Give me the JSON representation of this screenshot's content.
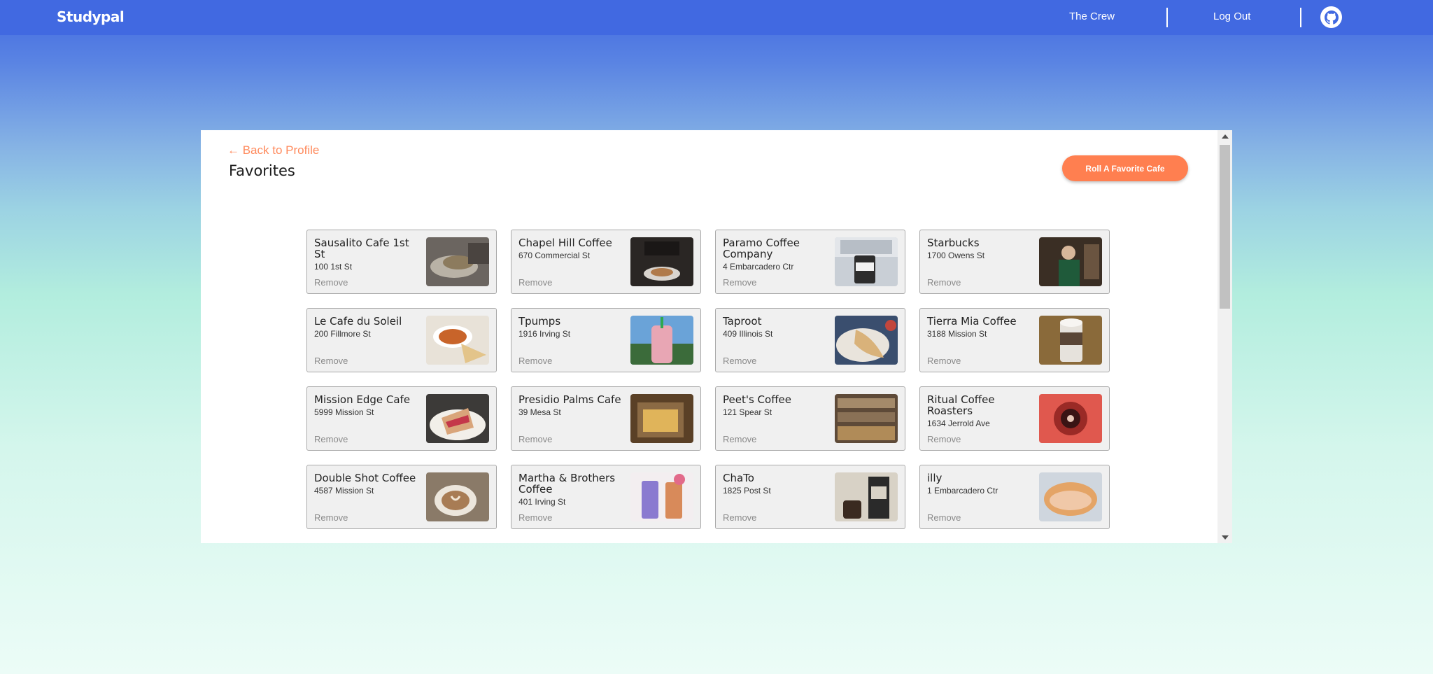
{
  "navbar": {
    "brand": "Studypal",
    "links": [
      "The Crew",
      "Log Out"
    ],
    "icon": "github-icon"
  },
  "page": {
    "back_link": "← Back to Profile",
    "title": "Favorites",
    "roll_button": "Roll A Favorite Cafe",
    "remove_label": "Remove"
  },
  "favorites": [
    {
      "name": "Sausalito Cafe 1st St",
      "address": "100 1st St",
      "photo": "sandwich-wrap-photo"
    },
    {
      "name": "Chapel Hill Coffee",
      "address": "670 Commercial St",
      "photo": "espresso-pour-photo"
    },
    {
      "name": "Paramo Coffee Company",
      "address": "4 Embarcadero Ctr",
      "photo": "coffee-cup-street-photo"
    },
    {
      "name": "Starbucks",
      "address": "1700 Owens St",
      "photo": "barista-photo"
    },
    {
      "name": "Le Cafe du Soleil",
      "address": "200 Fillmore St",
      "photo": "soup-bowl-photo"
    },
    {
      "name": "Tpumps",
      "address": "1916 Irving St",
      "photo": "pink-boba-drink-photo"
    },
    {
      "name": "Taproot",
      "address": "409 Illinois St",
      "photo": "pastry-plate-photo"
    },
    {
      "name": "Tierra Mia Coffee",
      "address": "3188 Mission St",
      "photo": "iced-mocha-photo"
    },
    {
      "name": "Mission Edge Cafe",
      "address": "5999 Mission St",
      "photo": "panini-photo"
    },
    {
      "name": "Presidio Palms Cafe",
      "address": "39 Mesa St",
      "photo": "takeout-box-photo"
    },
    {
      "name": "Peet's Coffee",
      "address": "121 Spear St",
      "photo": "store-shelves-photo"
    },
    {
      "name": "Ritual Coffee Roasters",
      "address": "1634 Jerrold Ave",
      "photo": "red-coffee-cup-photo"
    },
    {
      "name": "Double Shot Coffee",
      "address": "4587 Mission St",
      "photo": "latte-art-photo"
    },
    {
      "name": "Martha & Brothers Coffee",
      "address": "401 Irving St",
      "photo": "iced-drinks-photo"
    },
    {
      "name": "ChaTo",
      "address": "1825 Post St",
      "photo": "tea-package-photo"
    },
    {
      "name": "illy",
      "address": "1 Embarcadero Ctr",
      "photo": "croissant-sandwich-photo"
    }
  ],
  "colors": {
    "navbar": "#4169e1",
    "accent": "#ff7f50",
    "back_link": "#ff8a5c",
    "card_bg": "#f0f0f0"
  }
}
